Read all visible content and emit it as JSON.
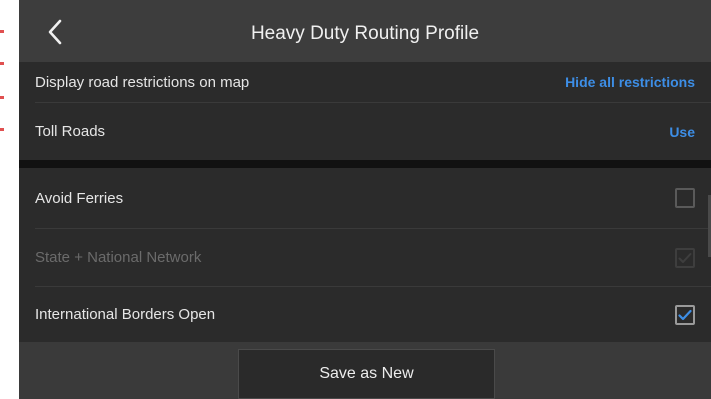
{
  "header": {
    "title": "Heavy Duty Routing Profile",
    "back_icon": "chevron-left-icon"
  },
  "settings_top": [
    {
      "label": "Display road restrictions on map",
      "action": "Hide all restrictions"
    },
    {
      "label": "Toll Roads",
      "action": "Use"
    }
  ],
  "settings_bottom": [
    {
      "label": "Avoid Ferries",
      "checked": false,
      "disabled": false
    },
    {
      "label": "State + National Network",
      "checked": true,
      "disabled": true
    },
    {
      "label": "International Borders Open",
      "checked": true,
      "disabled": false
    }
  ],
  "footer": {
    "save_label": "Save as New"
  },
  "colors": {
    "accent": "#3d8ee6",
    "background": "#2b2b2b",
    "header": "#3d3d3d",
    "check": "#3d8ee6"
  }
}
